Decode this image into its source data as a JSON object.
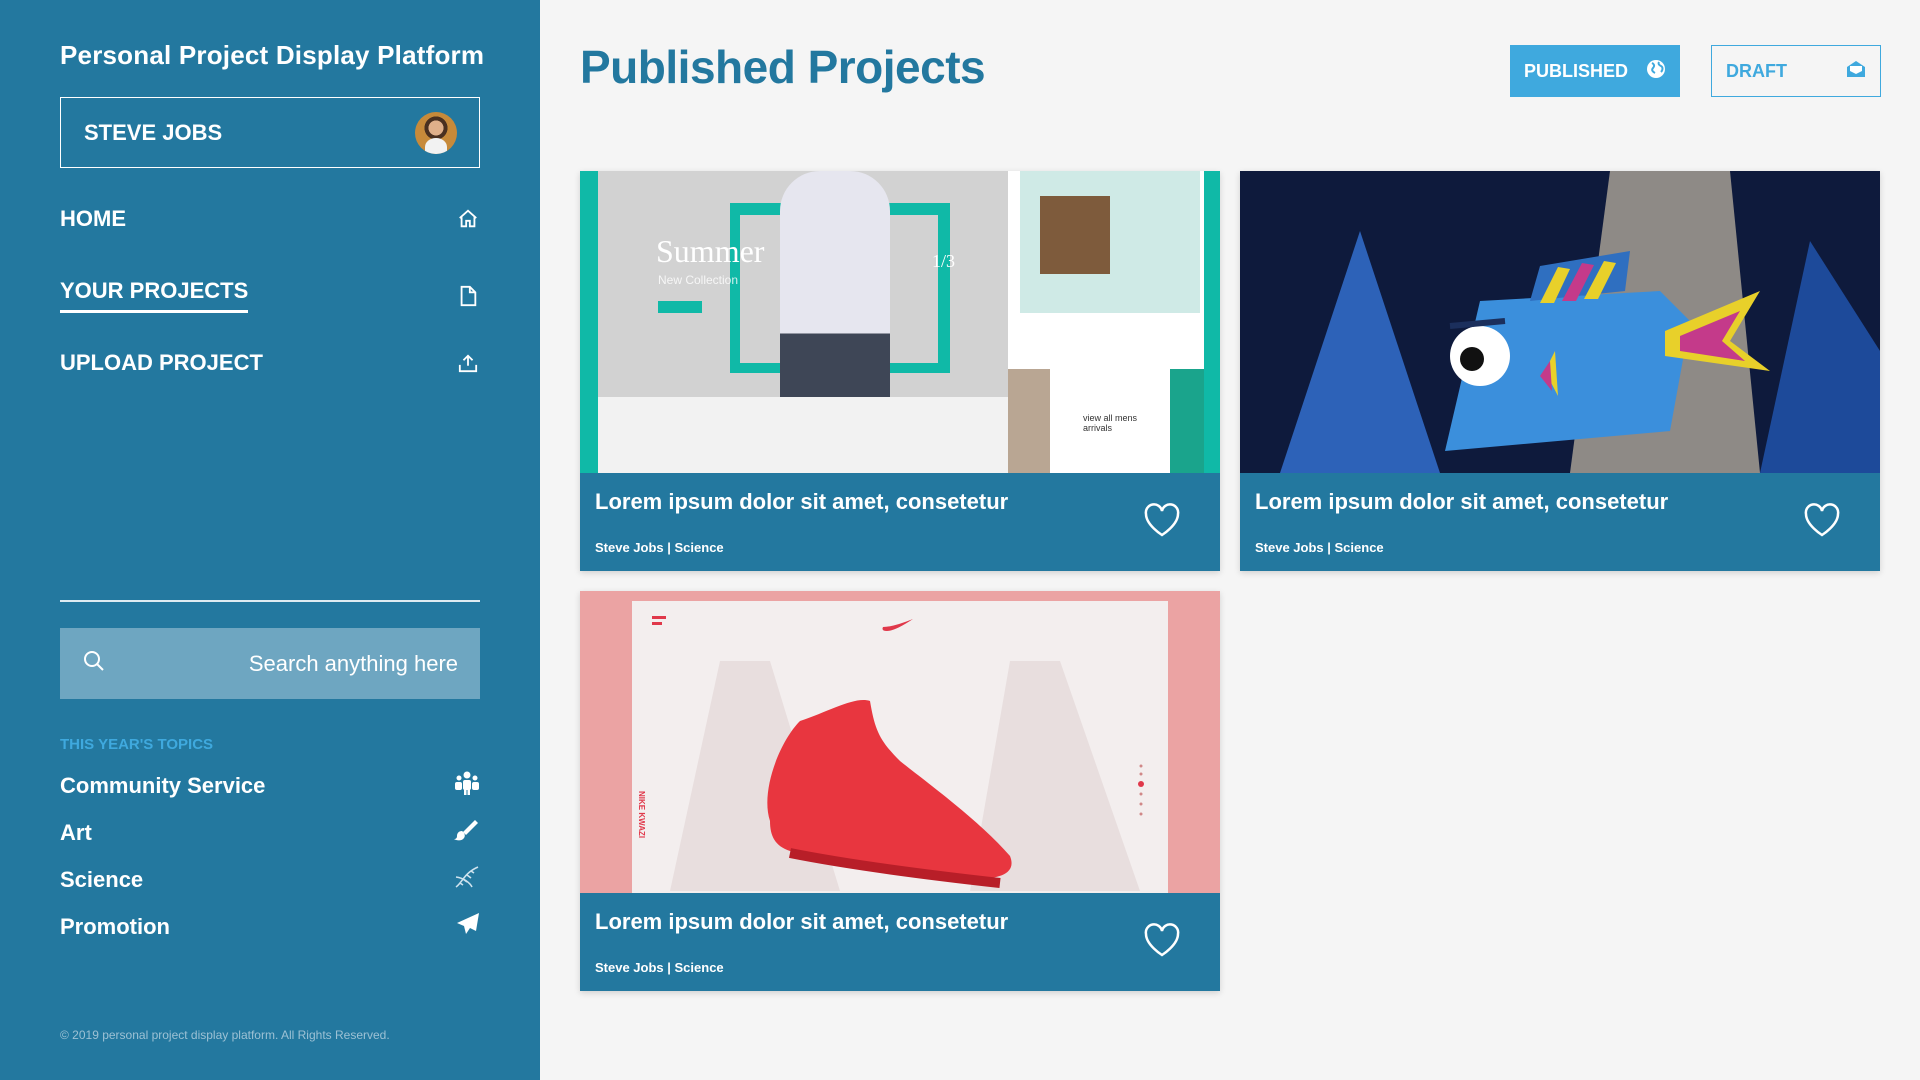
{
  "sidebar": {
    "brand": "Personal Project Display Platform",
    "user": {
      "name": "STEVE JOBS",
      "avatar_icon": "user-avatar"
    },
    "nav": [
      {
        "label": "HOME",
        "icon": "home-icon",
        "active": false
      },
      {
        "label": "YOUR PROJECTS",
        "icon": "document-icon",
        "active": true
      },
      {
        "label": "UPLOAD PROJECT",
        "icon": "upload-icon",
        "active": false
      }
    ],
    "search": {
      "placeholder": "Search anything here",
      "value": ""
    },
    "topics_title": "THIS YEAR'S TOPICS",
    "topics": [
      {
        "label": "Community Service",
        "icon": "people-icon"
      },
      {
        "label": "Art",
        "icon": "brush-icon"
      },
      {
        "label": "Science",
        "icon": "dna-icon"
      },
      {
        "label": "Promotion",
        "icon": "paper-plane-icon"
      }
    ],
    "copyright": "© 2019 personal project display platform. All Rights Reserved."
  },
  "main": {
    "title": "Published Projects",
    "buttons": {
      "published": {
        "label": "PUBLISHED",
        "icon": "globe-icon"
      },
      "draft": {
        "label": "DRAFT",
        "icon": "envelope-open-icon"
      }
    },
    "cards": [
      {
        "title": "Lorem ipsum dolor sit amet, consetetur",
        "meta": "Steve Jobs | Science",
        "thumb_text": {
          "heading": "Summer",
          "sub": "New Collection",
          "page": "1/3",
          "view": "view all mens arrivals"
        }
      },
      {
        "title": "Lorem ipsum dolor sit amet, consetetur",
        "meta": "Steve Jobs | Science"
      },
      {
        "title": "Lorem ipsum dolor sit amet, consetetur",
        "meta": "Steve Jobs | Science",
        "thumb_text": {
          "side": "NIKE KWAZI"
        }
      }
    ]
  },
  "colors": {
    "primary": "#23789f",
    "accent": "#3fa9de",
    "background": "#f5f5f5"
  }
}
